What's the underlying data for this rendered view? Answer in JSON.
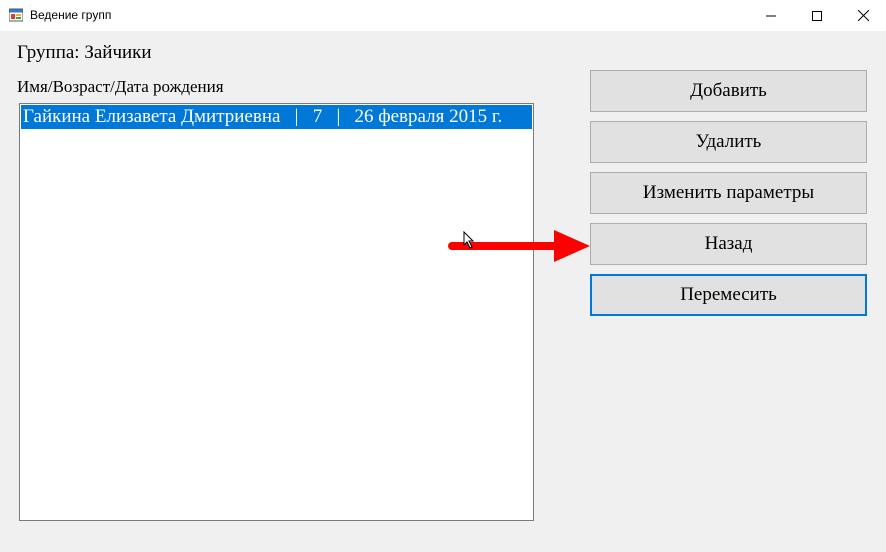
{
  "window": {
    "title": "Ведение групп",
    "icon": "form-app-icon",
    "controls": [
      "minimize-icon",
      "maximize-icon",
      "close-icon"
    ]
  },
  "group": {
    "label": "Группа: Зайчики"
  },
  "list": {
    "header": "Имя/Возраст/Дата рождения",
    "items": [
      {
        "text": "Гайкина Елизавета Дмитриевна   |   7   |   26 февраля 2015 г.",
        "selected": true
      }
    ]
  },
  "buttons": {
    "add": "Добавить",
    "delete": "Удалить",
    "edit": "Изменить параметры",
    "back": "Назад",
    "move": "Перемесить"
  },
  "colors": {
    "selection": "#0078d7",
    "button_bg": "#e1e1e1",
    "window_bg": "#f0f0f0",
    "annotation_arrow": "#ff0000"
  }
}
